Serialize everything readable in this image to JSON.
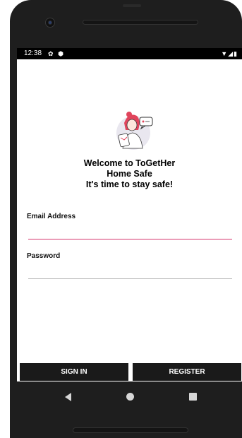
{
  "status_bar": {
    "time": "12:38",
    "left_icons": [
      "gear-icon",
      "shield-icon"
    ],
    "right_icons": [
      "wifi-icon",
      "signal-icon",
      "battery-icon"
    ]
  },
  "welcome": {
    "line1": "Welcome to ToGetHer",
    "line2": "Home Safe",
    "line3": "It's time to stay safe!"
  },
  "form": {
    "email_label": "Email Address",
    "email_value": "",
    "password_label": "Password",
    "password_value": ""
  },
  "buttons": {
    "sign_in": "SIGN IN",
    "register": "REGISTER"
  },
  "colors": {
    "accent": "#d6336c",
    "button_bg": "#1a1a1a",
    "status_bar_bg": "#000000"
  }
}
